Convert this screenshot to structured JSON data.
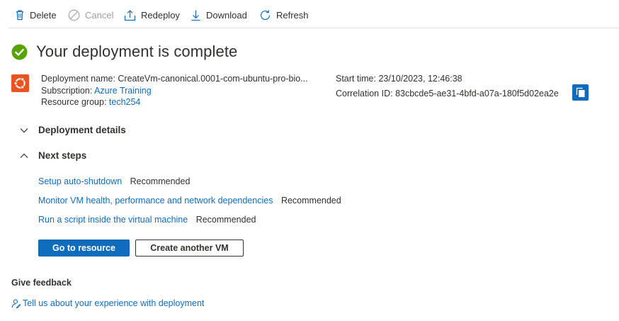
{
  "toolbar": {
    "delete_label": "Delete",
    "cancel_label": "Cancel",
    "redeploy_label": "Redeploy",
    "download_label": "Download",
    "refresh_label": "Refresh"
  },
  "header": {
    "title": "Your deployment is complete",
    "status_icon": "check-circle-icon",
    "status_color": "#57a300"
  },
  "deployment": {
    "name_label": "Deployment name:",
    "name_value": "CreateVm-canonical.0001-com-ubuntu-pro-bio...",
    "subscription_label": "Subscription:",
    "subscription_value": "Azure Training",
    "resource_group_label": "Resource group:",
    "resource_group_value": "tech254",
    "start_time_label": "Start time:",
    "start_time_value": "23/10/2023, 12:46:38",
    "correlation_label": "Correlation ID:",
    "correlation_value": "83cbcde5-ae31-4bfd-a07a-180f5d02ea2e"
  },
  "sections": {
    "details_label": "Deployment details",
    "next_steps_label": "Next steps"
  },
  "next_steps": [
    {
      "link": "Setup auto-shutdown",
      "tag": "Recommended"
    },
    {
      "link": "Monitor VM health, performance and network dependencies",
      "tag": "Recommended"
    },
    {
      "link": "Run a script inside the virtual machine",
      "tag": "Recommended"
    }
  ],
  "actions": {
    "go_to_resource": "Go to resource",
    "create_another": "Create another VM"
  },
  "feedback": {
    "heading": "Give feedback",
    "link": "Tell us about your experience with deployment"
  },
  "colors": {
    "accent": "#0f6cbd",
    "ubuntu": "#e95420",
    "success": "#57a300"
  }
}
